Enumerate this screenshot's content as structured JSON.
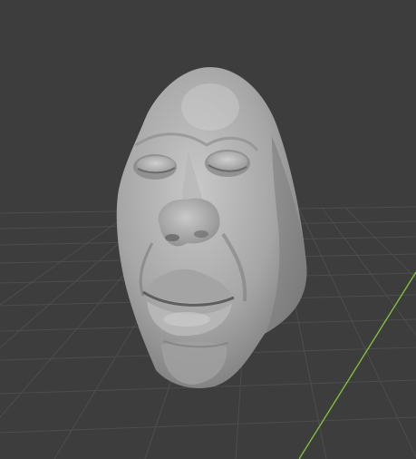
{
  "viewport": {
    "name": "3D Viewport",
    "background_color": "#3d3d3d",
    "grid_color": "#4d4d4d",
    "y_axis_color": "#7fbf3a",
    "sculpt_base_color": "#a9a9a9",
    "object": "sculpted-head"
  }
}
